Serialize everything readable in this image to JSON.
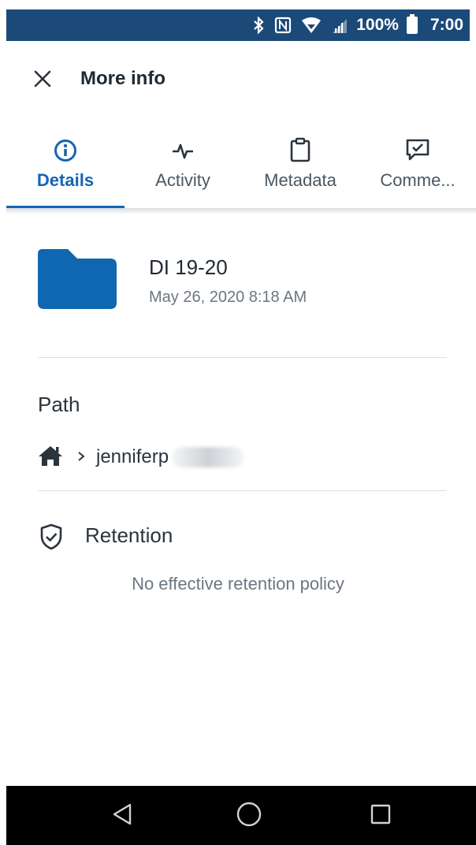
{
  "status_bar": {
    "battery_percent": "100%",
    "time": "7:00",
    "icons": [
      "bluetooth-icon",
      "nfc-icon",
      "wifi-icon",
      "signal-icon",
      "battery-icon"
    ],
    "background_color": "#1c4a78"
  },
  "header": {
    "title": "More info",
    "close_icon": "close-icon"
  },
  "tabs": [
    {
      "label": "Details",
      "icon": "info-icon",
      "active": true
    },
    {
      "label": "Activity",
      "icon": "activity-pulse-icon",
      "active": false
    },
    {
      "label": "Metadata",
      "icon": "clipboard-icon",
      "active": false
    },
    {
      "label": "Comme...",
      "icon": "comment-check-icon",
      "active": false
    }
  ],
  "file": {
    "name": "DI 19-20",
    "date": "May 26, 2020 8:18 AM",
    "icon": "folder-icon"
  },
  "path": {
    "heading": "Path",
    "home_icon": "home-icon",
    "user": "jenniferp"
  },
  "retention": {
    "heading": "Retention",
    "icon": "shield-check-icon",
    "message": "No effective retention policy"
  },
  "nav_bar": {
    "buttons": [
      "back-icon",
      "home-circle-icon",
      "recents-square-icon"
    ]
  },
  "colors": {
    "accent": "#1565b4",
    "folder": "#0f67b1"
  }
}
